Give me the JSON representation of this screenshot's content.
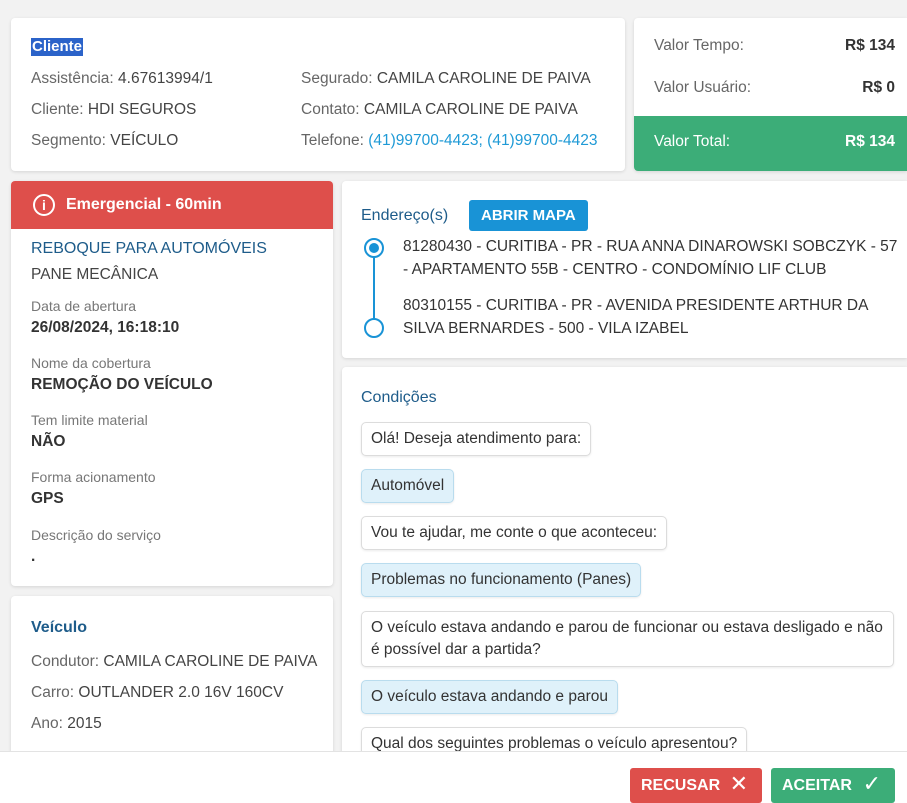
{
  "cliente": {
    "title": "Cliente",
    "assistencia_label": "Assistência:",
    "assistencia_value": "4.67613994/1",
    "cliente_label": "Cliente:",
    "cliente_value": "HDI SEGUROS",
    "segmento_label": "Segmento:",
    "segmento_value": "VEÍCULO",
    "segurado_label": "Segurado:",
    "segurado_value": "CAMILA CAROLINE DE PAIVA",
    "contato_label": "Contato:",
    "contato_value": "CAMILA CAROLINE DE PAIVA",
    "telefone_label": "Telefone:",
    "telefone_value": "(41)99700-4423; (41)99700-4423"
  },
  "valores": {
    "tempo_label": "Valor Tempo:",
    "tempo_value": "R$ 134",
    "usuario_label": "Valor Usuário:",
    "usuario_value": "R$ 0",
    "total_label": "Valor Total:",
    "total_value": "R$ 134"
  },
  "servico": {
    "priority": "Emergencial - 60min",
    "priority_icon": "info-icon",
    "title": "REBOQUE PARA AUTOMÓVEIS",
    "subtitle": "PANE MECÂNICA",
    "fields": [
      {
        "label": "Data de abertura",
        "value": "26/08/2024, 16:18:10"
      },
      {
        "label": "Nome da cobertura",
        "value": "REMOÇÃO DO VEÍCULO"
      },
      {
        "label": "Tem limite material",
        "value": "NÃO"
      },
      {
        "label": "Forma acionamento",
        "value": "GPS"
      },
      {
        "label": "Descrição do serviço",
        "value": "."
      }
    ]
  },
  "veiculo": {
    "title": "Veículo",
    "condutor_label": "Condutor:",
    "condutor_value": "CAMILA CAROLINE DE PAIVA",
    "carro_label": "Carro:",
    "carro_value": "OUTLANDER 2.0 16V 160CV",
    "ano_label": "Ano:",
    "ano_value": "2015"
  },
  "endereco": {
    "title": "Endereço(s)",
    "map_button": "ABRIR MAPA",
    "addresses": [
      "81280430 - CURITIBA - PR - RUA ANNA DINAROWSKI SOBCZYK - 57 - APARTAMENTO 55B - CENTRO - CONDOMÍNIO LIF CLUB",
      "80310155 - CURITIBA - PR - AVENIDA PRESIDENTE ARTHUR DA SILVA BERNARDES - 500 - VILA IZABEL"
    ]
  },
  "condicoes": {
    "title": "Condições",
    "messages": [
      {
        "type": "question",
        "text": "Olá! Deseja atendimento para:"
      },
      {
        "type": "answer",
        "text": "Automóvel"
      },
      {
        "type": "question",
        "text": "Vou te ajudar, me conte o que aconteceu:"
      },
      {
        "type": "answer",
        "text": "Problemas no funcionamento (Panes)"
      },
      {
        "type": "question",
        "text": "O veículo estava andando e parou de funcionar ou estava desligado e não é possível dar a partida?"
      },
      {
        "type": "answer",
        "text": "O veículo estava andando e parou"
      },
      {
        "type": "question",
        "text": "Qual dos seguintes problemas o veículo apresentou?"
      }
    ]
  },
  "footer": {
    "recusar": "RECUSAR",
    "aceitar": "ACEITAR",
    "recusar_icon": "close-icon",
    "aceitar_icon": "check-icon"
  },
  "colors": {
    "danger": "#de4f4b",
    "success": "#3cad78",
    "primary": "#1993d6",
    "heading": "#1e5c8a"
  }
}
